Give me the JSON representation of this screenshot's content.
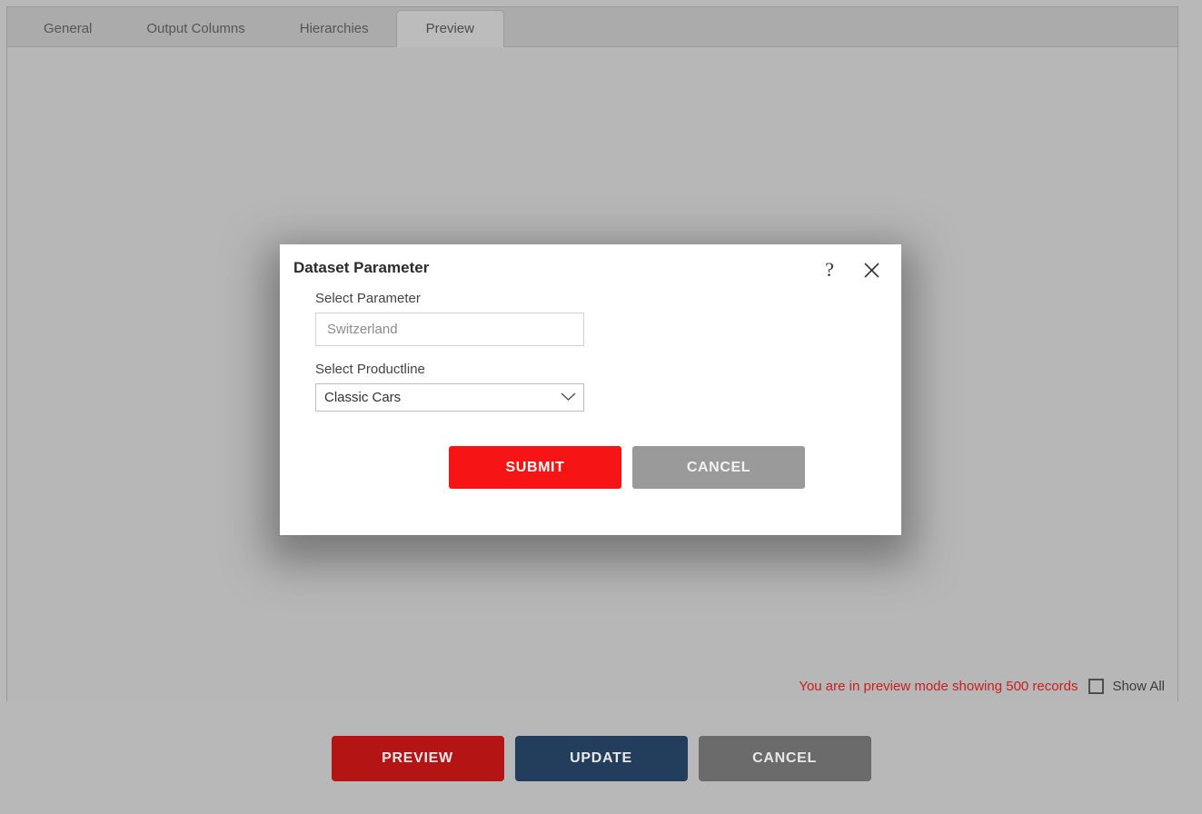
{
  "tabs": [
    {
      "label": "General",
      "active": false
    },
    {
      "label": "Output Columns",
      "active": false
    },
    {
      "label": "Hierarchies",
      "active": false
    },
    {
      "label": "Preview",
      "active": true
    }
  ],
  "preview_status": {
    "message": "You are in preview mode showing 500 records",
    "message_color": "#c62020",
    "show_all_label": "Show All",
    "show_all_checked": false
  },
  "dialog": {
    "title": "Dataset Parameter",
    "help_icon": "question-mark-icon",
    "close_icon": "close-icon",
    "fields": {
      "parameter": {
        "label": "Select Parameter",
        "value": "Switzerland",
        "placeholder": "Switzerland"
      },
      "productline": {
        "label": "Select Productline",
        "value": "Classic Cars",
        "chevron_icon": "chevron-down-icon"
      }
    },
    "submit_label": "SUBMIT",
    "cancel_label": "CANCEL",
    "submit_color": "#f71414",
    "cancel_color": "#9a9a9a"
  },
  "footer": {
    "preview_label": "PREVIEW",
    "update_label": "UPDATE",
    "cancel_label": "CANCEL",
    "preview_color": "#b51414",
    "update_color": "#223e5c",
    "cancel_color": "#6b6b6b"
  }
}
